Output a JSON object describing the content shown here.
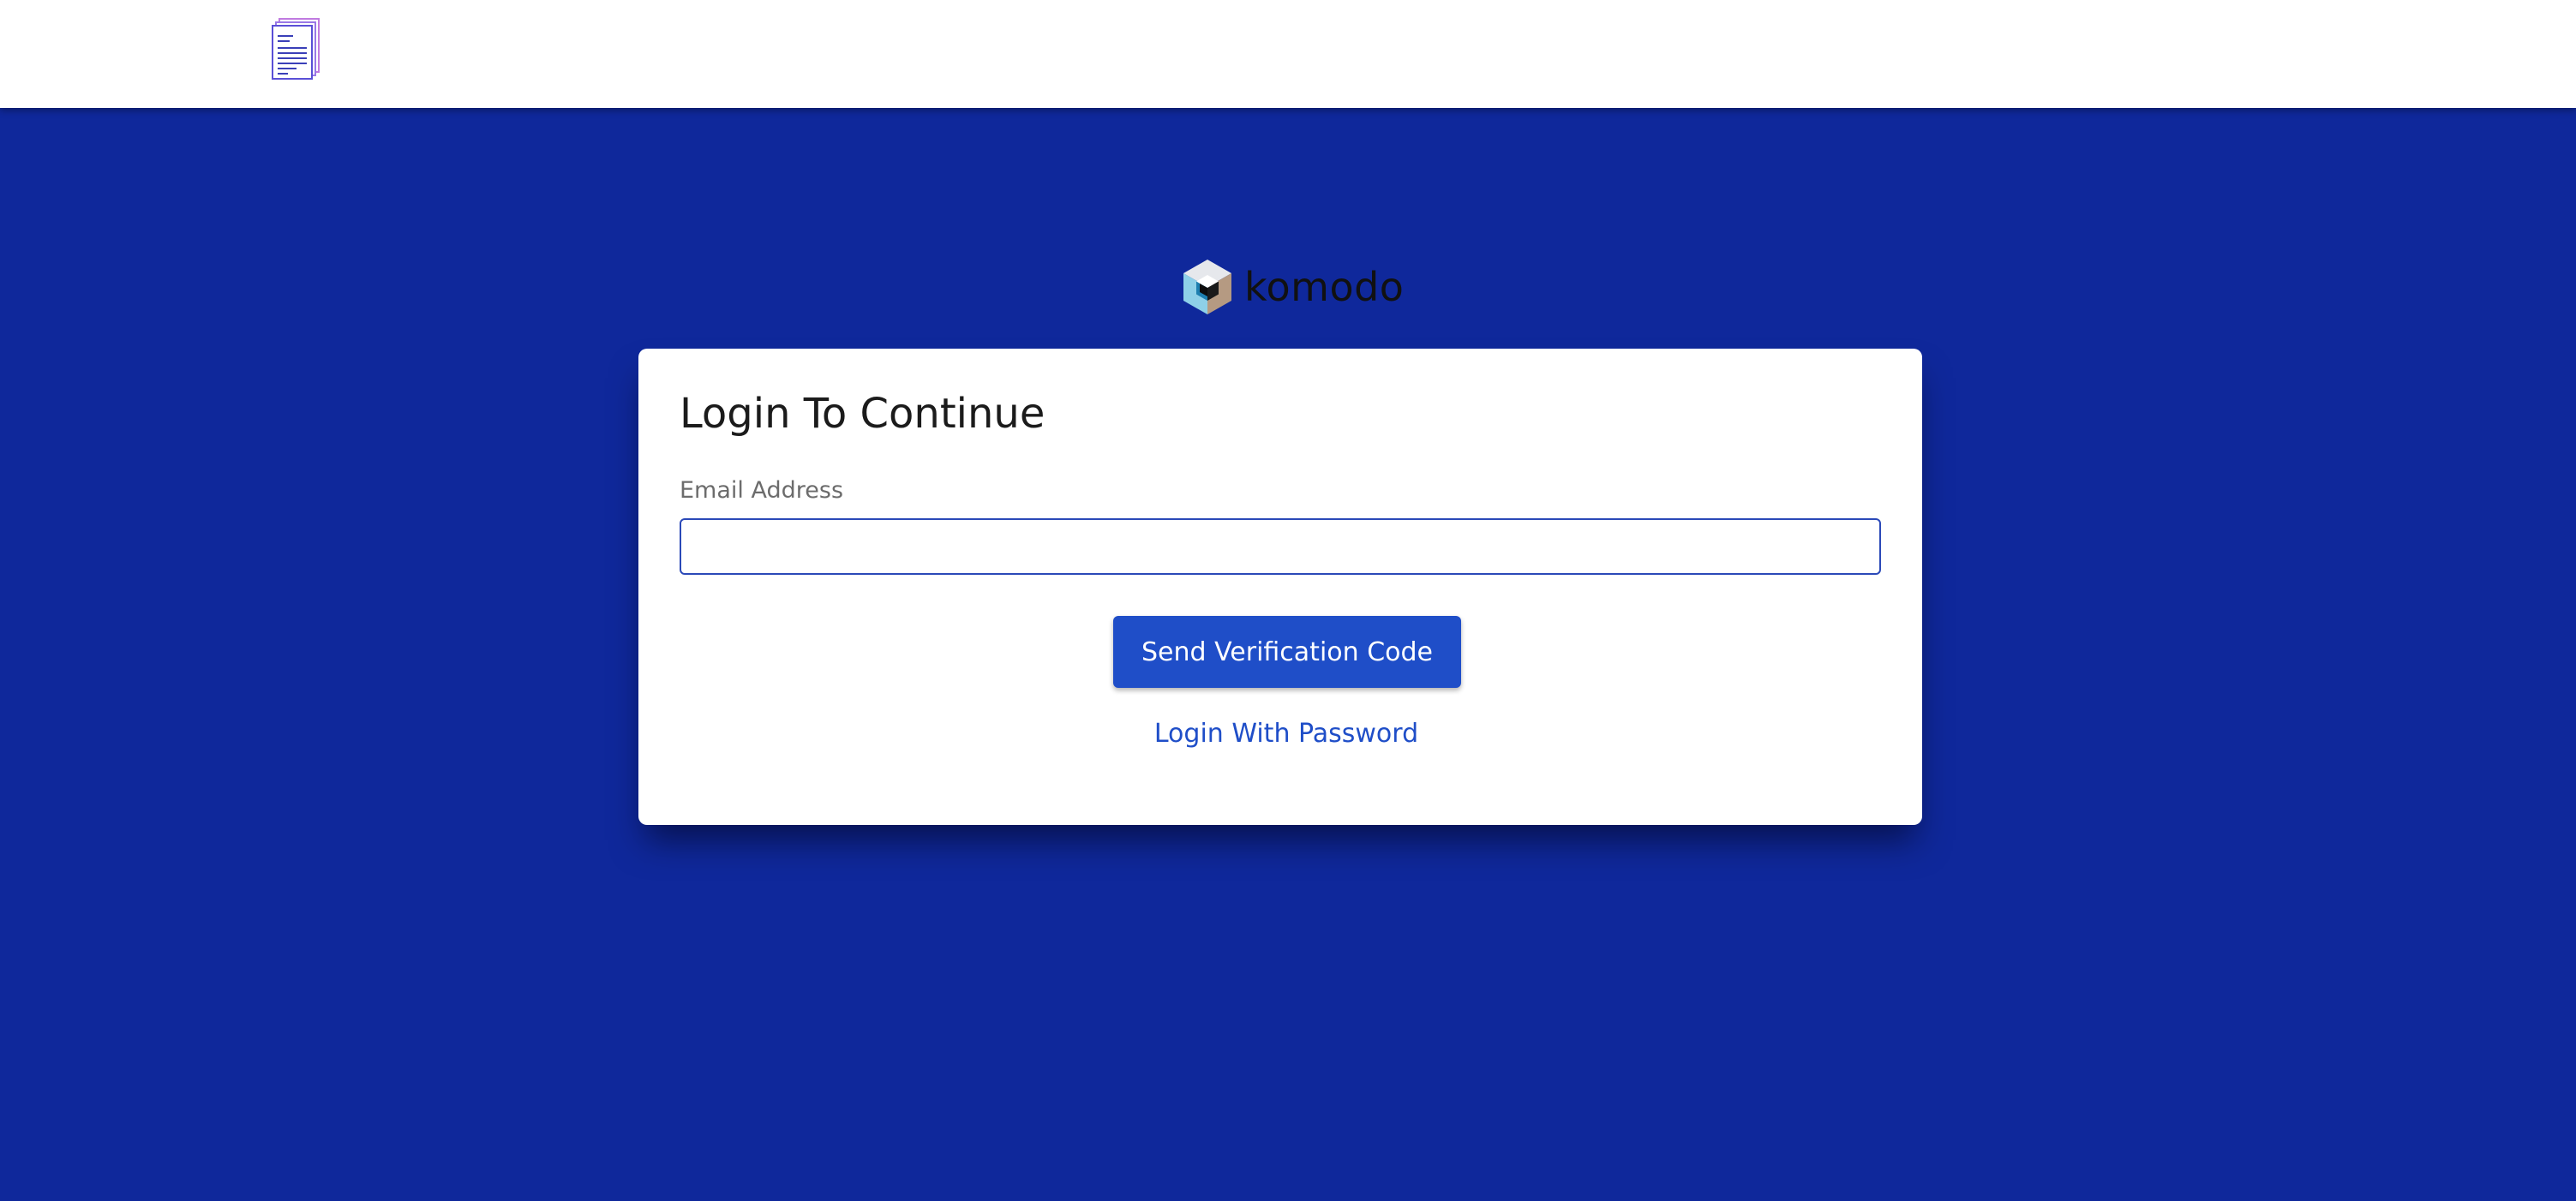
{
  "header": {
    "icon": "document-stack-icon"
  },
  "brand": {
    "logo_icon": "komodo-cube-icon",
    "name": "komodo"
  },
  "login": {
    "title": "Login To Continue",
    "email_label": "Email Address",
    "email_value": "",
    "email_placeholder": "",
    "send_button_label": "Send Verification Code",
    "password_link_label": "Login With Password"
  },
  "colors": {
    "background": "#0f289b",
    "accent": "#1f4ec8",
    "input_border": "#2b49b8",
    "card": "#ffffff"
  }
}
